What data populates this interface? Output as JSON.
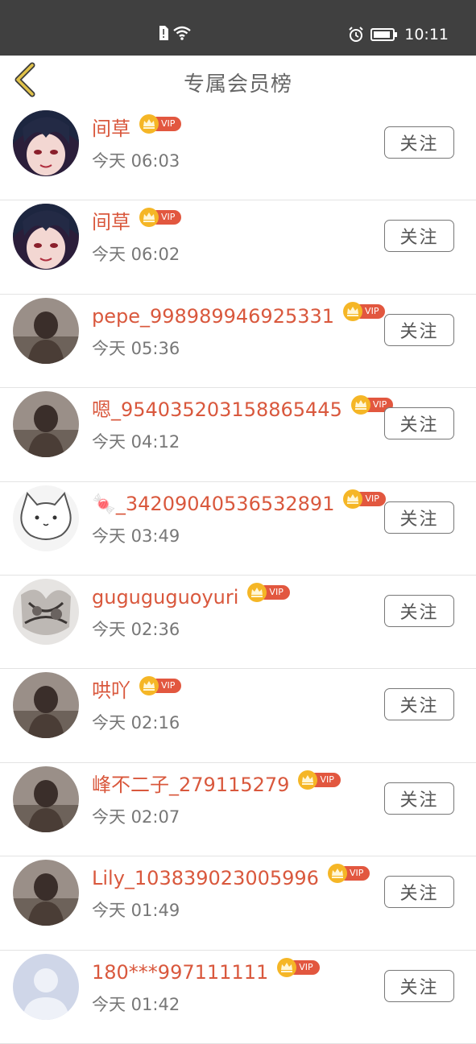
{
  "status_bar": {
    "time": "10:11"
  },
  "header": {
    "title": "专属会员榜"
  },
  "vip_label": "VIP",
  "follow_label": "关注",
  "members": [
    {
      "name": "间草",
      "time": "今天 06:03",
      "avatar": "anime-avatar-icon"
    },
    {
      "name": "间草",
      "time": "今天 06:02",
      "avatar": "anime-avatar-icon"
    },
    {
      "name": "pepe_998989946925331",
      "time": "今天 05:36",
      "avatar": "photo-avatar-icon"
    },
    {
      "name": "嗯_954035203158865445",
      "time": "今天 04:12",
      "avatar": "photo-avatar-icon"
    },
    {
      "name": "🍬_34209040536532891",
      "time": "今天 03:49",
      "avatar": "cat-sketch-avatar-icon"
    },
    {
      "name": "guguguguoyuri",
      "time": "今天 02:36",
      "avatar": "sketch-avatar-icon"
    },
    {
      "name": "哄吖",
      "time": "今天 02:16",
      "avatar": "photo-avatar-icon"
    },
    {
      "name": "峰不二子_279115279",
      "time": "今天 02:07",
      "avatar": "photo-avatar-icon"
    },
    {
      "name": "Lily_103839023005996",
      "time": "今天 01:49",
      "avatar": "photo-avatar-icon"
    },
    {
      "name": "180***997111111",
      "time": "今天 01:42",
      "avatar": "default-avatar-icon"
    }
  ],
  "colors": {
    "accent": "#d9583d",
    "vip_badge": "#e2573f",
    "crown": "#f5b626",
    "back_arrow": "#c9a227"
  }
}
